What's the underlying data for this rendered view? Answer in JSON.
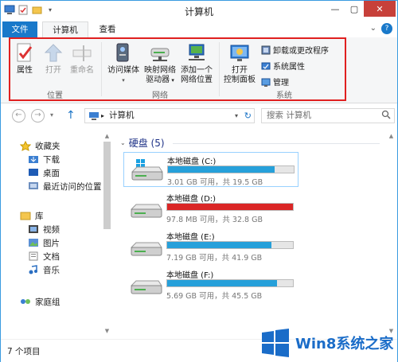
{
  "window": {
    "title": "计算机"
  },
  "tabs": [
    {
      "label": "文件"
    },
    {
      "label": "计算机"
    },
    {
      "label": "查看"
    }
  ],
  "ribbon": {
    "location_group": {
      "name": "位置",
      "properties": "属性",
      "open": "打开",
      "rename": "重命名"
    },
    "network_group": {
      "name": "网络",
      "access_media": "访问媒体",
      "map_drive_line1": "映射网络",
      "map_drive_line2": "驱动器",
      "add_location_line1": "添加一个",
      "add_location_line2": "网络位置"
    },
    "system_group": {
      "name": "系统",
      "open_control_line1": "打开",
      "open_control_line2": "控制面板",
      "uninstall": "卸载或更改程序",
      "system_properties": "系统属性",
      "manage": "管理"
    }
  },
  "address": {
    "path": "计算机",
    "search_placeholder": "搜索 计算机"
  },
  "nav": {
    "favorites": "收藏夹",
    "downloads": "下载",
    "desktop": "桌面",
    "recent": "最近访问的位置",
    "libraries": "库",
    "videos": "视频",
    "pictures": "图片",
    "documents": "文档",
    "music": "音乐",
    "homegroup": "家庭组"
  },
  "content": {
    "group_title": "硬盘 (5)",
    "drives": [
      {
        "name": "本地磁盘 (C:)",
        "info": "3.01 GB 可用，共 19.5 GB",
        "used_fraction": 0.85,
        "color": "#26a0da"
      },
      {
        "name": "本地磁盘 (D:)",
        "info": "97.8 MB 可用，共 32.8 GB",
        "used_fraction": 0.997,
        "color": "#da2626"
      },
      {
        "name": "本地磁盘 (E:)",
        "info": "7.19 GB 可用，共 41.9 GB",
        "used_fraction": 0.83,
        "color": "#26a0da"
      },
      {
        "name": "本地磁盘 (F:)",
        "info": "5.69 GB 可用，共 45.5 GB",
        "used_fraction": 0.875,
        "color": "#26a0da"
      }
    ]
  },
  "status": {
    "item_count": "7 个项目"
  },
  "watermark": {
    "text": "Win8系统之家"
  }
}
